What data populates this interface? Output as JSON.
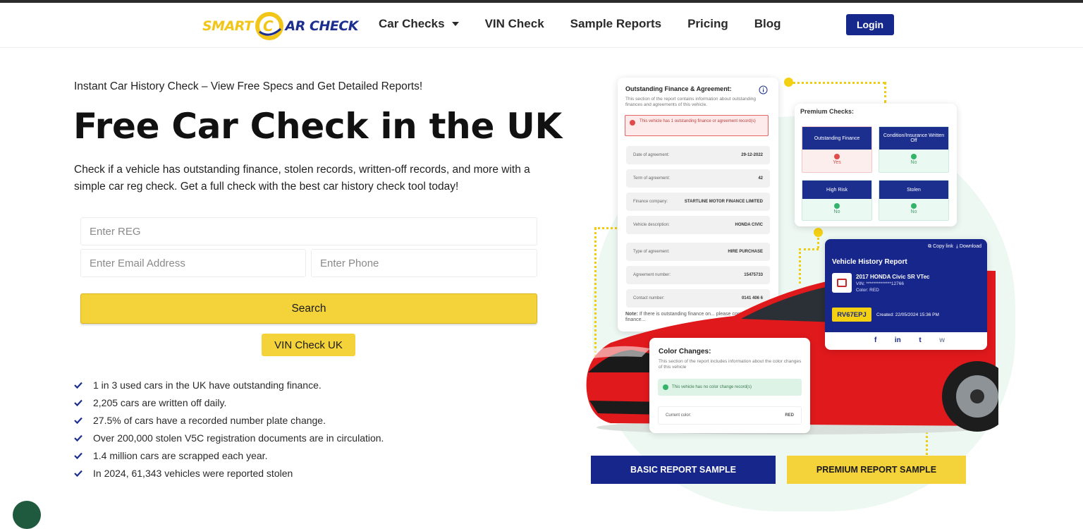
{
  "header": {
    "logo": {
      "part1": "SMART",
      "part2": "AR CHECK",
      "ring_letter": "C"
    },
    "nav": [
      {
        "label": "Car Checks",
        "dropdown": true
      },
      {
        "label": "VIN Check"
      },
      {
        "label": "Sample Reports"
      },
      {
        "label": "Pricing"
      },
      {
        "label": "Blog"
      }
    ],
    "login_label": "Login"
  },
  "hero": {
    "tagline": "Instant Car History Check – View Free Specs and Get Detailed Reports!",
    "title": "Free Car Check in the UK",
    "description": "Check if a vehicle has outstanding finance, stolen records, written-off records, and more with a simple car reg check. Get a full check with the best car history check tool today!"
  },
  "form": {
    "reg_placeholder": "Enter REG",
    "email_placeholder": "Enter Email Address",
    "phone_placeholder": "Enter Phone",
    "search_label": "Search",
    "vin_label": "VIN Check UK"
  },
  "facts": [
    "1 in 3 used cars in the UK have outstanding finance.",
    "2,205 cars are written off daily.",
    "27.5% of cars have a recorded number plate change.",
    "Over 200,000 stolen V5C registration documents are in circulation.",
    "1.4 million cars are scrapped each year.",
    "In 2024, 61,343 vehicles were reported stolen"
  ],
  "finance_card": {
    "title": "Outstanding Finance & Agreement:",
    "subtitle": "This section of the report contains information about outstanding finances and agreements of this vehicle.",
    "alert": "This vehicle has 1 outstanding finance or agreement record(s)",
    "rows": [
      {
        "label": "Date of agreement:",
        "value": "29-12-2022"
      },
      {
        "label": "Term of agreement:",
        "value": "42"
      },
      {
        "label": "Finance company:",
        "value": "STARTLINE MOTOR FINANCE LIMITED"
      },
      {
        "label": "Vehicle description:",
        "value": "HONDA CIVIC"
      },
      {
        "label": "Type of agreement:",
        "value": "HIRE PURCHASE"
      },
      {
        "label": "Agreement number:",
        "value": "15475733"
      },
      {
        "label": "Contact number:",
        "value": "0141 406 6"
      }
    ],
    "note_bold": "Note:",
    "note": "If there is outstanding finance on... please contact the finance..."
  },
  "premium_card": {
    "title": "Premium Checks:",
    "items": [
      {
        "label": "Outstanding Finance",
        "value": "Yes",
        "status": "bad"
      },
      {
        "label": "Condition/Insurance Written Off",
        "value": "No",
        "status": "good"
      },
      {
        "label": "High Risk",
        "value": "No",
        "status": "good"
      },
      {
        "label": "Stolen",
        "value": "No",
        "status": "good"
      }
    ]
  },
  "history_card": {
    "copy_link": "Copy link",
    "download": "Download",
    "title": "Vehicle History Report",
    "vehicle": "2017 HONDA Civic SR VTec",
    "vin": "VIN: **************12766",
    "color": "Color: RED",
    "plate": "RV67EPJ",
    "created": "Created: 22/05/2024 15:36 PM",
    "social": [
      "f",
      "in",
      "t",
      "w"
    ]
  },
  "color_card": {
    "title": "Color Changes:",
    "subtitle": "This section of the report includes information about the color changes of this vehicle",
    "ok": "This vehicle has no color change record(s)",
    "current_label": "Current color:",
    "current_value": "RED"
  },
  "samples": {
    "basic_label": "BASIC REPORT SAMPLE",
    "premium_label": "PREMIUM REPORT SAMPLE"
  },
  "colors": {
    "navy": "#1c2f8f",
    "yellow": "#f4d23a",
    "car_red": "#e0191c"
  }
}
